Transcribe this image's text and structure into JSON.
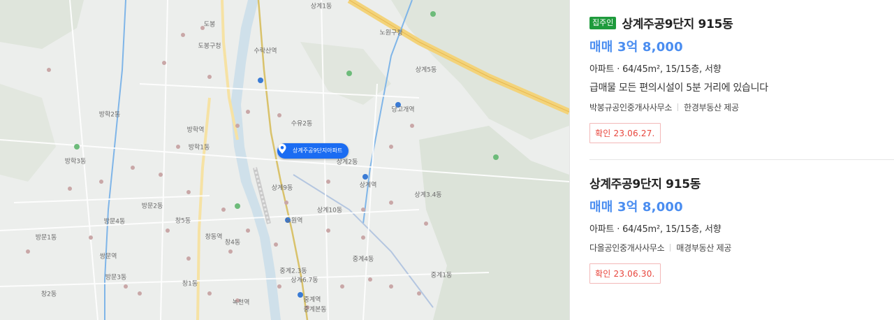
{
  "map": {
    "marker_label": "상계주공9단지아파트",
    "labels": [
      {
        "text": "상계1동"
      },
      {
        "text": "도봉"
      },
      {
        "text": "방학2동"
      },
      {
        "text": "방학1동"
      },
      {
        "text": "방학3동"
      },
      {
        "text": "방문2동"
      },
      {
        "text": "방문4동"
      },
      {
        "text": "방문1동"
      },
      {
        "text": "방문3동"
      },
      {
        "text": "창5동"
      },
      {
        "text": "창4동"
      },
      {
        "text": "창1동"
      },
      {
        "text": "창2동"
      },
      {
        "text": "수유2동"
      },
      {
        "text": "상계9동"
      },
      {
        "text": "상계10동"
      },
      {
        "text": "상계2동"
      },
      {
        "text": "상계5동"
      },
      {
        "text": "상계3.4동"
      },
      {
        "text": "중계4동"
      },
      {
        "text": "중계1동"
      },
      {
        "text": "중계본동"
      },
      {
        "text": "중계2.3동"
      },
      {
        "text": "상계6.7동"
      },
      {
        "text": "녹천역"
      },
      {
        "text": "노원역"
      },
      {
        "text": "수락산역"
      },
      {
        "text": "방학역"
      },
      {
        "text": "쌍문역"
      },
      {
        "text": "당고개역"
      },
      {
        "text": "상계역"
      },
      {
        "text": "중계역"
      },
      {
        "text": "창동역"
      },
      {
        "text": "도봉구청"
      },
      {
        "text": "노원구청"
      }
    ]
  },
  "listings": [
    {
      "badge": "집주인",
      "title": "상계주공9단지 915동",
      "price": "매매 3억 8,000",
      "spec": "아파트 · 64/45m², 15/15층, 서향",
      "desc": "급매물 모든 편의시설이 5분 거리에 있습니다",
      "agent": "박봉규공인중개사사무소",
      "provider": "한경부동산 제공",
      "confirm": "확인 23.06.27."
    },
    {
      "title": "상계주공9단지 915동",
      "price": "매매 3억 8,000",
      "spec": "아파트 · 64/45m², 15/15층, 서향",
      "agent": "다올공인중개사사무소",
      "provider": "매경부동산 제공",
      "confirm": "확인 23.06.30."
    }
  ],
  "colors": {
    "accent": "#1b6cf2",
    "price": "#4a8df0",
    "badge": "#1e9b3c",
    "confirm": "#e8453c"
  }
}
